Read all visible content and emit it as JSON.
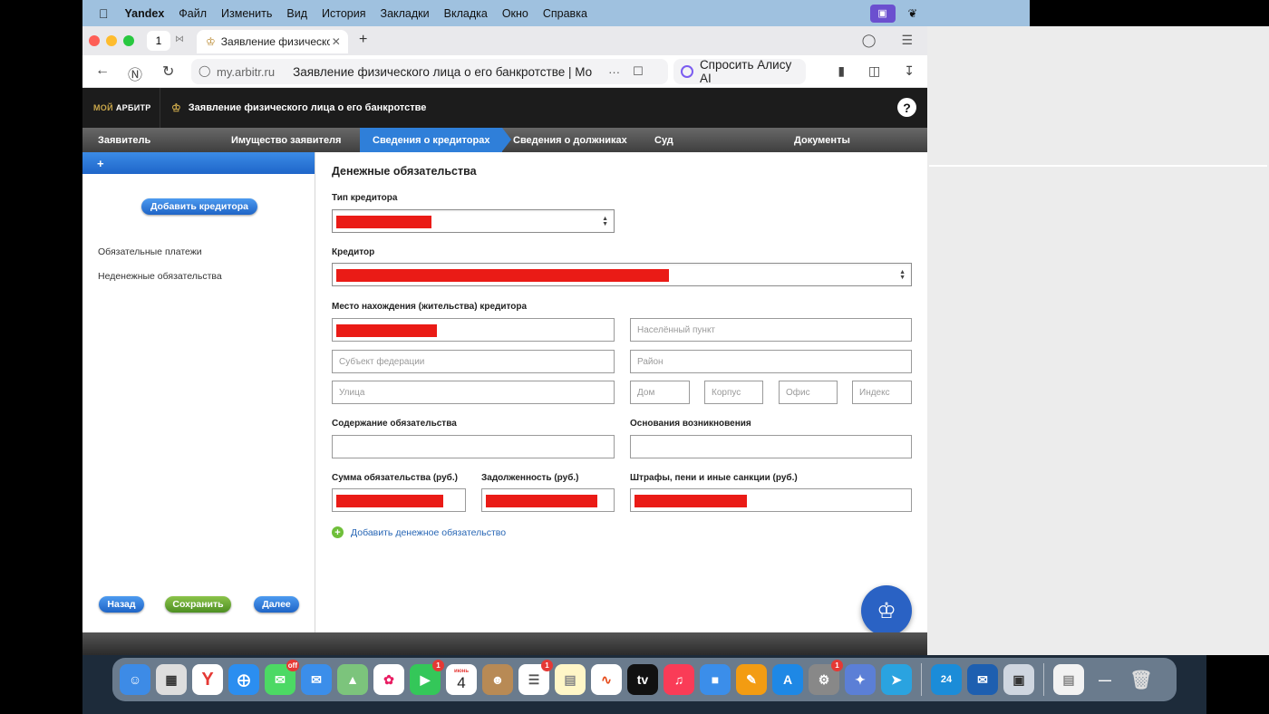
{
  "menubar": {
    "apple": "",
    "items": [
      "Yandex",
      "Файл",
      "Изменить",
      "Вид",
      "История",
      "Закладки",
      "Вкладка",
      "Окно",
      "Справка"
    ],
    "lang": "РУ"
  },
  "browser": {
    "tab_count": "1",
    "tab_title": "Заявление физическо",
    "host": "my.arbitr.ru",
    "page_title": "Заявление физического лица о его банкротстве | Мо...",
    "dots": "···",
    "alice_label": "Спросить Алису AI"
  },
  "site": {
    "logo_moi": "МОЙ",
    "logo_arbitr": "АРБИТР",
    "header_title": "Заявление физического лица о его банкротстве",
    "help": "?",
    "steps": [
      "Заявитель",
      "Имущество заявителя",
      "Сведения о кредиторах",
      "Сведения о должниках",
      "Суд",
      "Документы"
    ],
    "active_step": "Сведения о кредиторах"
  },
  "sidebar": {
    "bar_plus": "+",
    "add_creditor": "Добавить кредитора",
    "links": [
      "Обязательные платежи",
      "Неденежные обязательства"
    ],
    "back": "Назад",
    "save": "Сохранить",
    "next": "Далее"
  },
  "form": {
    "section_title": "Денежные обязательства",
    "creditor_type_label": "Тип кредитора",
    "creditor_label": "Кредитор",
    "location_label": "Место нахождения (жительства) кредитора",
    "placeholders": {
      "city": "Населённый пункт",
      "region": "Субъект федерации",
      "district": "Район",
      "street": "Улица",
      "house": "Дом",
      "building": "Корпус",
      "office": "Офис",
      "index": "Индекс"
    },
    "content_label": "Содержание обязательства",
    "basis_label": "Основания возникновения",
    "sum_label": "Сумма обязательства (руб.)",
    "debt_label": "Задолженность (руб.)",
    "fines_label": "Штрафы, пени и иные санкции (руб.)",
    "add_obligation": "Добавить денежное обязательство",
    "redacted_color": "#ea1b16"
  },
  "dock": {
    "calendar_month": "июнь",
    "calendar_day": "4",
    "badges": {
      "messages": "off",
      "facetime": "1",
      "reminders": "1",
      "settings": "1"
    },
    "clock_label": "24"
  }
}
